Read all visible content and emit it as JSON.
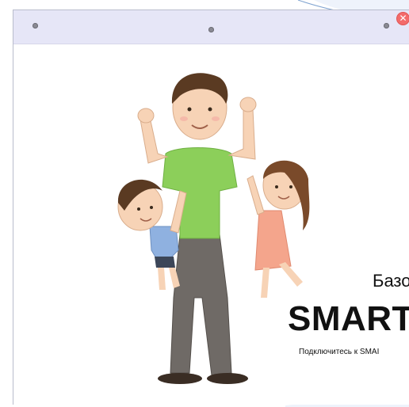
{
  "window": {
    "close_glyph": "✕"
  },
  "promo": {
    "heading": "Базо",
    "brand": "SMART",
    "subtitle": "Подключитесь к SMAI"
  },
  "icons": {
    "close": "close-icon"
  },
  "colors": {
    "titlebar": "#e6e6f7",
    "close_button": "#f36b6b",
    "shirt": "#8ccf5a",
    "pants": "#6f6a66",
    "boy_shirt": "#8fb1e0",
    "girl_dress": "#f4a58c"
  }
}
